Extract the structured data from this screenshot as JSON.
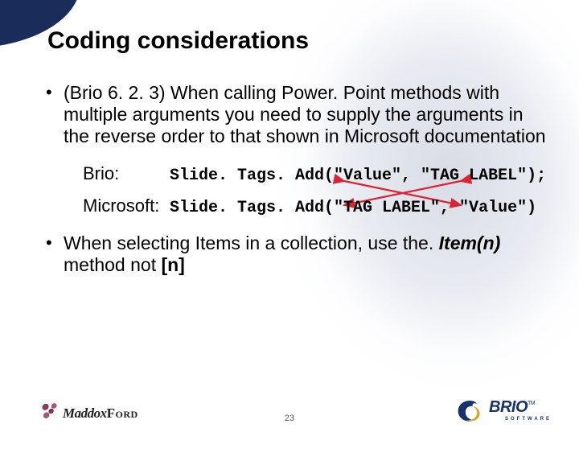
{
  "title": "Coding considerations",
  "bullets": [
    {
      "text": "(Brio 6. 2. 3) When calling Power. Point methods with multiple arguments you need to supply the arguments in the reverse order to that shown in Microsoft documentation",
      "examples": [
        {
          "label": "Brio:",
          "code": "Slide. Tags. Add(\"Value\", \"TAG LABEL\");"
        },
        {
          "label": "Microsoft:",
          "code": "Slide. Tags. Add(\"TAG LABEL\", \"Value\")"
        }
      ]
    },
    {
      "prefix": "When selecting Items in a collection, use the. ",
      "method": "Item(n)",
      "middle": " method not ",
      "bracket": "[n]"
    }
  ],
  "page_number": "23",
  "logos": {
    "left": {
      "part1": "Maddox",
      "part2": "Ford"
    },
    "right": {
      "name": "BRIO",
      "sub": "SOFTWARE",
      "tm": "TM"
    }
  }
}
